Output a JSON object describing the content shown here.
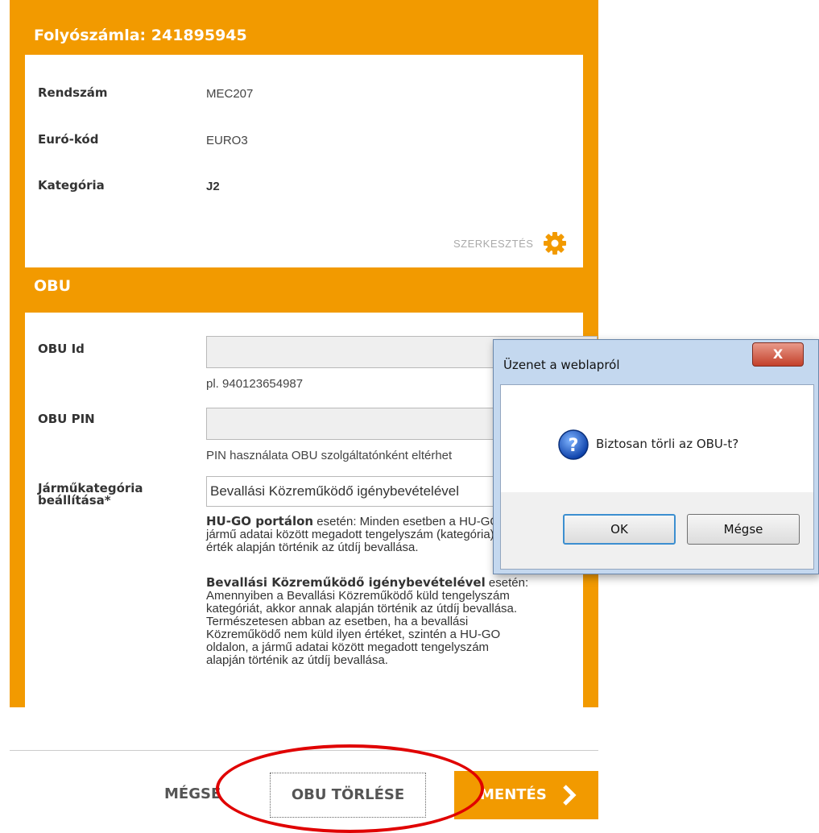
{
  "account": {
    "title": "Folyószámla: 241895945"
  },
  "vehicle": {
    "plate_label": "Rendszám",
    "plate_value": "MEC207",
    "euro_label": "Euró-kód",
    "euro_value": "EURO3",
    "category_label": "Kategória",
    "category_value": "J2",
    "edit_label": "SZERKESZTÉS"
  },
  "obu": {
    "section_title": "OBU",
    "id_label": "OBU Id",
    "id_value": "",
    "id_hint": "pl. 940123654987",
    "pin_label": "OBU PIN",
    "pin_value": "",
    "pin_hint": "PIN használata OBU szolgáltatónként eltérhet",
    "category_label_1": "Járműkategória",
    "category_label_2": "beállítása*",
    "category_selected": "Bevallási Közreműködő igénybevételével",
    "desc1_bold": "HU-GO portálon",
    "desc1_line1": " esetén: Minden esetben a HU-GO oldalon, a",
    "desc1_line2": "jármű adatai között megadott tengelyszám (kategória)",
    "desc1_line3": "érték alapján történik az útdíj bevallása.",
    "desc2_bold": "Bevallási Közreműködő igénybevételével",
    "desc2_line1": " esetén:",
    "desc2_line2": "Amennyiben a Bevallási Közreműködő küld tengelyszám",
    "desc2_line3": "kategóriát, akkor annak alapján történik az útdíj bevallása.",
    "desc2_line4": "Természetesen abban az esetben, ha a bevallási",
    "desc2_line5": "Közreműködő nem küld ilyen értéket, szintén a HU-GO",
    "desc2_line6": "oldalon, a jármű adatai között megadott tengelyszám",
    "desc2_line7": "alapján történik az útdíj bevallása."
  },
  "footer": {
    "cancel_label": "MÉGSE",
    "delete_label": "OBU TÖRLÉSE",
    "save_label": "MENTÉS"
  },
  "dialog": {
    "title": "Üzenet a weblapról",
    "close_label": "X",
    "message": "Biztosan törli az OBU-t?",
    "ok_label": "OK",
    "cancel_label": "Mégse"
  },
  "colors": {
    "accent": "#f29a00",
    "highlight": "#e00000"
  }
}
